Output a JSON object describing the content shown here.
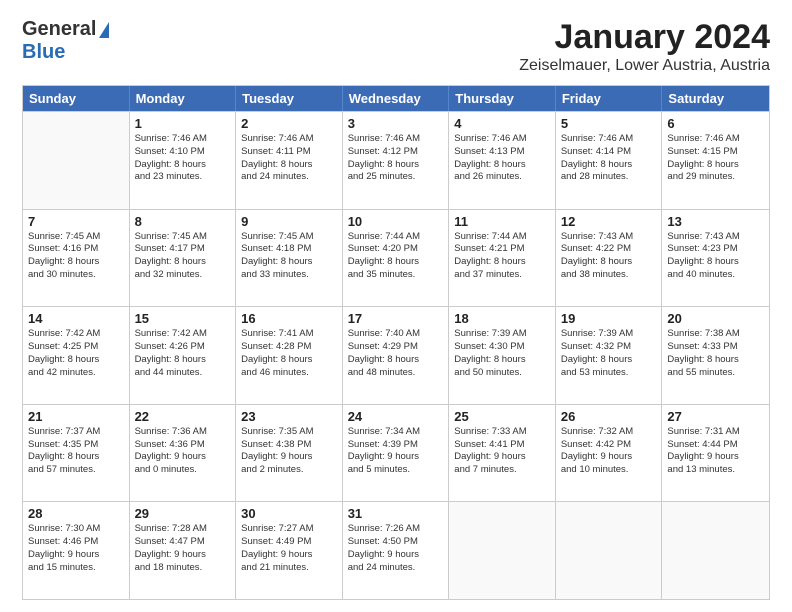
{
  "header": {
    "logo_general": "General",
    "logo_blue": "Blue",
    "main_title": "January 2024",
    "subtitle": "Zeiselmauer, Lower Austria, Austria"
  },
  "calendar": {
    "days_of_week": [
      "Sunday",
      "Monday",
      "Tuesday",
      "Wednesday",
      "Thursday",
      "Friday",
      "Saturday"
    ],
    "weeks": [
      [
        {
          "day": "",
          "info": ""
        },
        {
          "day": "1",
          "info": "Sunrise: 7:46 AM\nSunset: 4:10 PM\nDaylight: 8 hours\nand 23 minutes."
        },
        {
          "day": "2",
          "info": "Sunrise: 7:46 AM\nSunset: 4:11 PM\nDaylight: 8 hours\nand 24 minutes."
        },
        {
          "day": "3",
          "info": "Sunrise: 7:46 AM\nSunset: 4:12 PM\nDaylight: 8 hours\nand 25 minutes."
        },
        {
          "day": "4",
          "info": "Sunrise: 7:46 AM\nSunset: 4:13 PM\nDaylight: 8 hours\nand 26 minutes."
        },
        {
          "day": "5",
          "info": "Sunrise: 7:46 AM\nSunset: 4:14 PM\nDaylight: 8 hours\nand 28 minutes."
        },
        {
          "day": "6",
          "info": "Sunrise: 7:46 AM\nSunset: 4:15 PM\nDaylight: 8 hours\nand 29 minutes."
        }
      ],
      [
        {
          "day": "7",
          "info": "Sunrise: 7:45 AM\nSunset: 4:16 PM\nDaylight: 8 hours\nand 30 minutes."
        },
        {
          "day": "8",
          "info": "Sunrise: 7:45 AM\nSunset: 4:17 PM\nDaylight: 8 hours\nand 32 minutes."
        },
        {
          "day": "9",
          "info": "Sunrise: 7:45 AM\nSunset: 4:18 PM\nDaylight: 8 hours\nand 33 minutes."
        },
        {
          "day": "10",
          "info": "Sunrise: 7:44 AM\nSunset: 4:20 PM\nDaylight: 8 hours\nand 35 minutes."
        },
        {
          "day": "11",
          "info": "Sunrise: 7:44 AM\nSunset: 4:21 PM\nDaylight: 8 hours\nand 37 minutes."
        },
        {
          "day": "12",
          "info": "Sunrise: 7:43 AM\nSunset: 4:22 PM\nDaylight: 8 hours\nand 38 minutes."
        },
        {
          "day": "13",
          "info": "Sunrise: 7:43 AM\nSunset: 4:23 PM\nDaylight: 8 hours\nand 40 minutes."
        }
      ],
      [
        {
          "day": "14",
          "info": "Sunrise: 7:42 AM\nSunset: 4:25 PM\nDaylight: 8 hours\nand 42 minutes."
        },
        {
          "day": "15",
          "info": "Sunrise: 7:42 AM\nSunset: 4:26 PM\nDaylight: 8 hours\nand 44 minutes."
        },
        {
          "day": "16",
          "info": "Sunrise: 7:41 AM\nSunset: 4:28 PM\nDaylight: 8 hours\nand 46 minutes."
        },
        {
          "day": "17",
          "info": "Sunrise: 7:40 AM\nSunset: 4:29 PM\nDaylight: 8 hours\nand 48 minutes."
        },
        {
          "day": "18",
          "info": "Sunrise: 7:39 AM\nSunset: 4:30 PM\nDaylight: 8 hours\nand 50 minutes."
        },
        {
          "day": "19",
          "info": "Sunrise: 7:39 AM\nSunset: 4:32 PM\nDaylight: 8 hours\nand 53 minutes."
        },
        {
          "day": "20",
          "info": "Sunrise: 7:38 AM\nSunset: 4:33 PM\nDaylight: 8 hours\nand 55 minutes."
        }
      ],
      [
        {
          "day": "21",
          "info": "Sunrise: 7:37 AM\nSunset: 4:35 PM\nDaylight: 8 hours\nand 57 minutes."
        },
        {
          "day": "22",
          "info": "Sunrise: 7:36 AM\nSunset: 4:36 PM\nDaylight: 9 hours\nand 0 minutes."
        },
        {
          "day": "23",
          "info": "Sunrise: 7:35 AM\nSunset: 4:38 PM\nDaylight: 9 hours\nand 2 minutes."
        },
        {
          "day": "24",
          "info": "Sunrise: 7:34 AM\nSunset: 4:39 PM\nDaylight: 9 hours\nand 5 minutes."
        },
        {
          "day": "25",
          "info": "Sunrise: 7:33 AM\nSunset: 4:41 PM\nDaylight: 9 hours\nand 7 minutes."
        },
        {
          "day": "26",
          "info": "Sunrise: 7:32 AM\nSunset: 4:42 PM\nDaylight: 9 hours\nand 10 minutes."
        },
        {
          "day": "27",
          "info": "Sunrise: 7:31 AM\nSunset: 4:44 PM\nDaylight: 9 hours\nand 13 minutes."
        }
      ],
      [
        {
          "day": "28",
          "info": "Sunrise: 7:30 AM\nSunset: 4:46 PM\nDaylight: 9 hours\nand 15 minutes."
        },
        {
          "day": "29",
          "info": "Sunrise: 7:28 AM\nSunset: 4:47 PM\nDaylight: 9 hours\nand 18 minutes."
        },
        {
          "day": "30",
          "info": "Sunrise: 7:27 AM\nSunset: 4:49 PM\nDaylight: 9 hours\nand 21 minutes."
        },
        {
          "day": "31",
          "info": "Sunrise: 7:26 AM\nSunset: 4:50 PM\nDaylight: 9 hours\nand 24 minutes."
        },
        {
          "day": "",
          "info": ""
        },
        {
          "day": "",
          "info": ""
        },
        {
          "day": "",
          "info": ""
        }
      ]
    ]
  }
}
